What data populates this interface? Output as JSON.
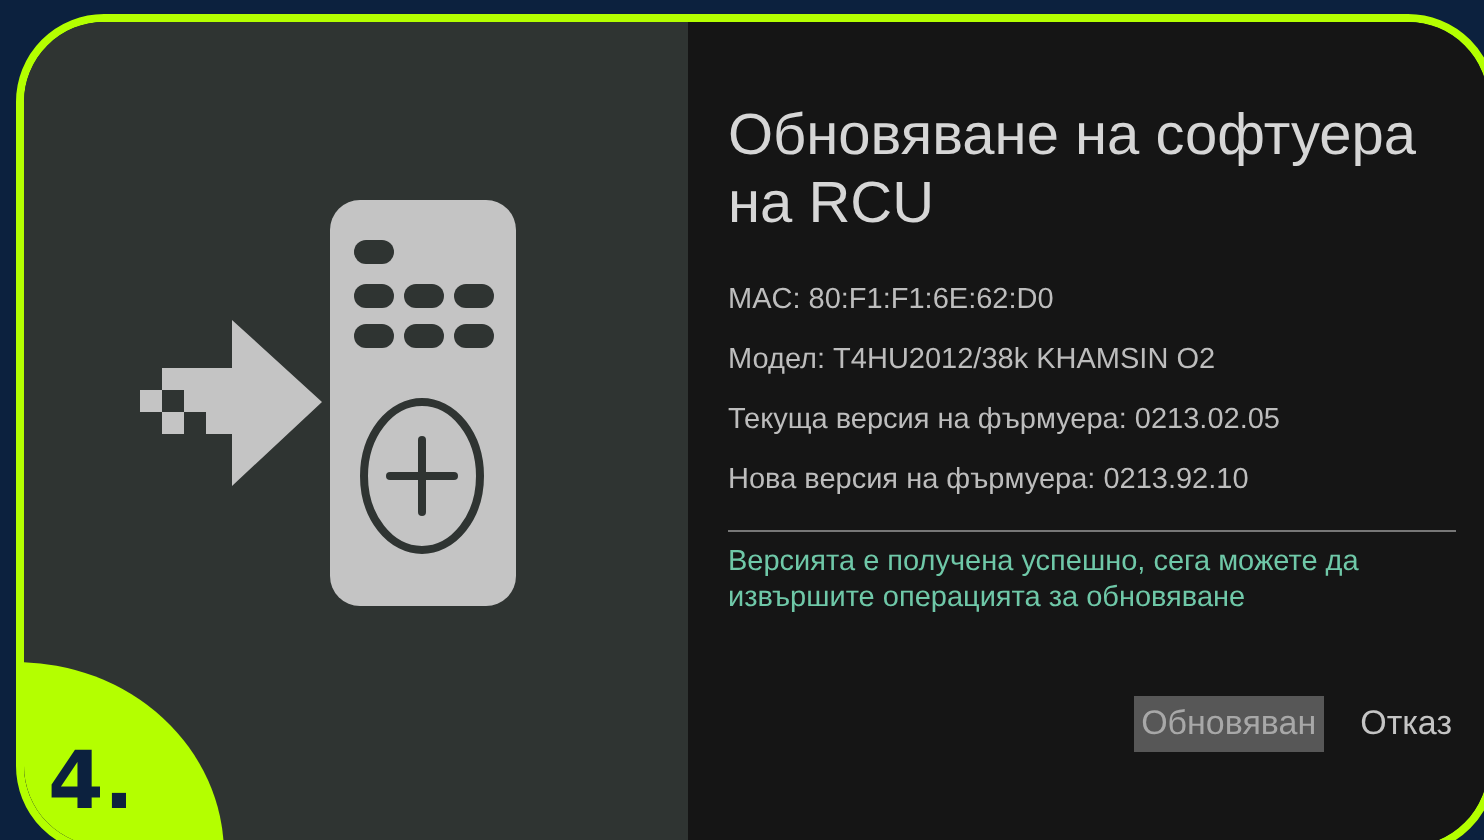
{
  "step_badge": "4.",
  "dialog": {
    "title": "Обновяване на софтуера на RCU",
    "info_lines": [
      "MAC: 80:F1:F1:6E:62:D0",
      "Модел: T4HU2012/38k KHAMSIN O2",
      "Текуща версия на фърмуера: 0213.02.05",
      "Нова версия на фърмуера: 0213.92.10"
    ],
    "message": "Версията е получена успешно, сега можете да извършите операцията за обновяване",
    "buttons": [
      {
        "label": "Обновяван",
        "selected": true
      },
      {
        "label": "Отказ",
        "selected": false
      }
    ]
  }
}
